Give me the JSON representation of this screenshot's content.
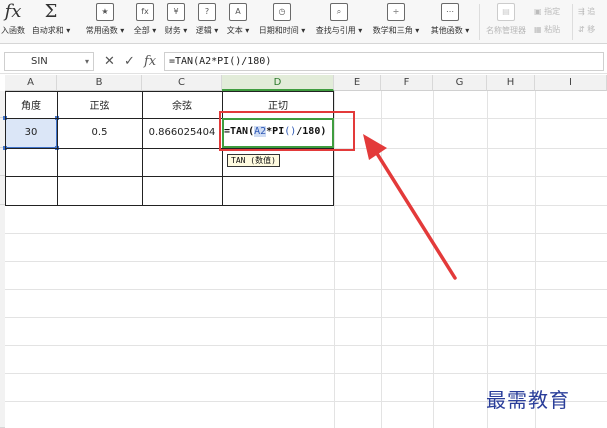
{
  "ribbon": {
    "fx_label": "入函数",
    "buttons": [
      {
        "id": "autosum",
        "icon": "sigma-icon",
        "label": "自动求和",
        "caret": true
      },
      {
        "id": "recent",
        "icon": "recent-functions-icon",
        "label": "常用函数",
        "caret": true
      },
      {
        "id": "all",
        "icon": "all-functions-icon",
        "label": "全部",
        "caret": true
      },
      {
        "id": "financial",
        "icon": "financial-icon",
        "label": "财务",
        "caret": true
      },
      {
        "id": "logical",
        "icon": "logical-icon",
        "label": "逻辑",
        "caret": true
      },
      {
        "id": "text",
        "icon": "text-function-icon",
        "label": "文本",
        "caret": true
      },
      {
        "id": "datetime",
        "icon": "datetime-icon",
        "label": "日期和时间",
        "caret": true
      },
      {
        "id": "lookup",
        "icon": "lookup-icon",
        "label": "查找与引用",
        "caret": true
      },
      {
        "id": "math",
        "icon": "math-icon",
        "label": "数学和三角",
        "caret": true
      },
      {
        "id": "more",
        "icon": "more-functions-icon",
        "label": "其他函数",
        "caret": true
      }
    ],
    "name_manager_label": "名称管理器",
    "specify_label": "指定",
    "paste_label": "粘贴",
    "trace_label": "追",
    "trace2_label": "移"
  },
  "formula_bar": {
    "name_box": "SIN",
    "cancel_glyph": "✕",
    "enter_glyph": "✓",
    "fx_glyph": "fx",
    "formula": "=TAN(A2*PI()/180)"
  },
  "columns": [
    "A",
    "B",
    "C",
    "D",
    "E",
    "F",
    "G",
    "H",
    "I"
  ],
  "table": {
    "headers": [
      "角度",
      "正弦",
      "余弦",
      "正切"
    ],
    "row2": [
      "30",
      "0.5",
      "0.866025404"
    ]
  },
  "editing": {
    "prefix": "=TAN(",
    "ref": "A2",
    "mid": "*PI",
    "paren": "()",
    "tail": "/180)"
  },
  "tooltip": "TAN (数值)",
  "watermark": "最需教育",
  "colors": {
    "accent_green": "#3f9d3f",
    "selection_blue": "#3f72c9",
    "highlight_red": "#e33a3a",
    "watermark_blue": "#2a3e9a"
  }
}
